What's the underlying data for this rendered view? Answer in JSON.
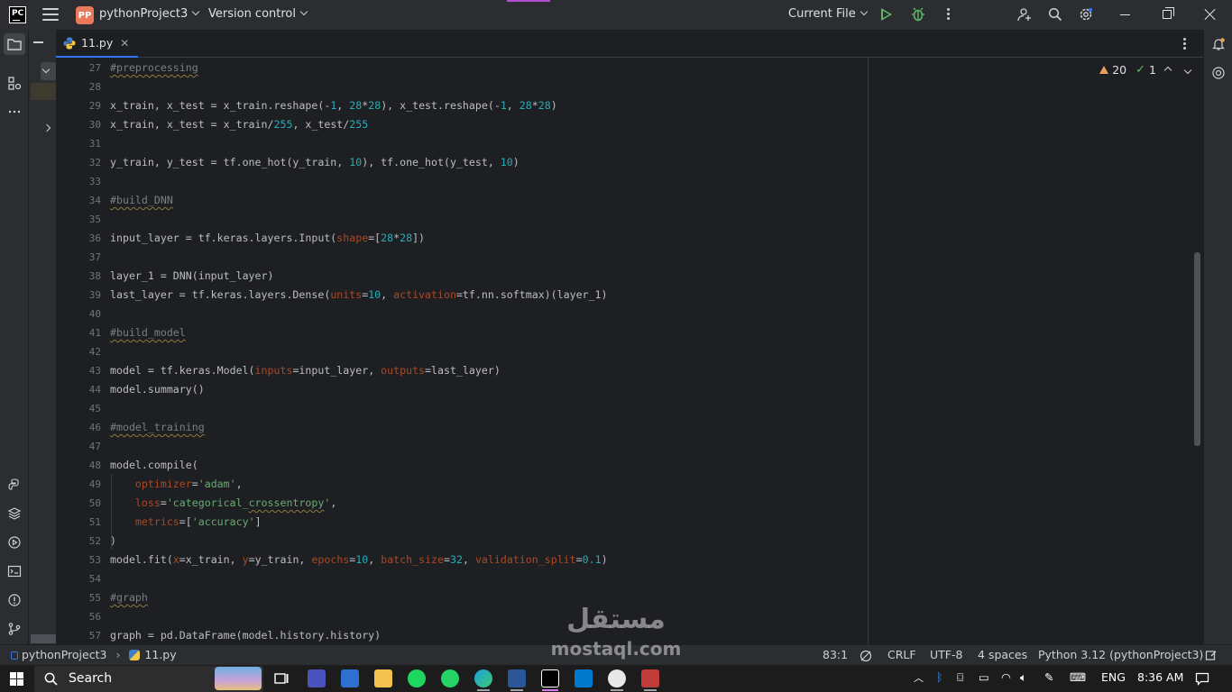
{
  "titlebar": {
    "project_badge": "PP",
    "project_name": "pythonProject3",
    "version_control": "Version control",
    "run_config": "Current File"
  },
  "tabs": [
    {
      "label": "11.py",
      "close": "✕"
    }
  ],
  "inspections": {
    "warnings": "20",
    "weak_warnings": "1"
  },
  "editor": {
    "lines": [
      {
        "no": "27",
        "html": "<span class=\"cm-w\">#preprocessing</span>"
      },
      {
        "no": "28",
        "html": ""
      },
      {
        "no": "29",
        "html": "x_train, x_test = x_train.reshape(-<span class=\"num\">1</span>, <span class=\"num\">28</span>*<span class=\"num\">28</span>), x_test.reshape(-<span class=\"num\">1</span>, <span class=\"num\">28</span>*<span class=\"num\">28</span>)"
      },
      {
        "no": "30",
        "html": "x_train, x_test = x_train/<span class=\"num\">255</span>, x_test/<span class=\"num\">255</span>"
      },
      {
        "no": "31",
        "html": ""
      },
      {
        "no": "32",
        "html": "y_train, y_test = tf.one_hot(y_train, <span class=\"num\">10</span>), tf.one_hot(y_test, <span class=\"num\">10</span>)"
      },
      {
        "no": "33",
        "html": ""
      },
      {
        "no": "34",
        "html": "<span class=\"cm-w\">#build_DNN</span>"
      },
      {
        "no": "35",
        "html": ""
      },
      {
        "no": "36",
        "html": "input_layer = tf.keras.layers.Input(<span class=\"kw\">shape</span>=[<span class=\"num\">28</span>*<span class=\"num\">28</span>])"
      },
      {
        "no": "37",
        "html": ""
      },
      {
        "no": "38",
        "html": "layer_1 = DNN(input_layer)"
      },
      {
        "no": "39",
        "html": "last_layer = tf.keras.layers.Dense(<span class=\"kw\">units</span>=<span class=\"num\">10</span>, <span class=\"kw\">activation</span>=tf.nn.softmax)(layer_1)"
      },
      {
        "no": "40",
        "html": ""
      },
      {
        "no": "41",
        "html": "<span class=\"cm-w\">#build_model</span>"
      },
      {
        "no": "42",
        "html": ""
      },
      {
        "no": "43",
        "html": "model = tf.keras.Model(<span class=\"kw\">inputs</span>=input_layer, <span class=\"kw\">outputs</span>=last_layer)"
      },
      {
        "no": "44",
        "html": "model.summary()"
      },
      {
        "no": "45",
        "html": ""
      },
      {
        "no": "46",
        "html": "<span class=\"cm-w\">#model_training</span>"
      },
      {
        "no": "47",
        "html": ""
      },
      {
        "no": "48",
        "html": "model.compile("
      },
      {
        "no": "49",
        "html": "    <span class=\"kw\">optimizer</span>=<span class=\"str\">'adam'</span>,"
      },
      {
        "no": "50",
        "html": "    <span class=\"kw\">loss</span>=<span class=\"str\">'categorical_<span class=\"cm-w\" style=\"color:#6aab73\">crossentropy</span>'</span>,"
      },
      {
        "no": "51",
        "html": "    <span class=\"kw\">metrics</span>=[<span class=\"str\">'accuracy'</span>]"
      },
      {
        "no": "52",
        "html": ")"
      },
      {
        "no": "53",
        "html": "model.fit(<span class=\"kw\">x</span>=x_train, <span class=\"kw\">y</span>=y_train, <span class=\"kw\">epochs</span>=<span class=\"num\">10</span>, <span class=\"kw\">batch_size</span>=<span class=\"num\">32</span>, <span class=\"kw\">validation_split</span>=<span class=\"num\">0.1</span>)"
      },
      {
        "no": "54",
        "html": ""
      },
      {
        "no": "55",
        "html": "<span class=\"cm-w\">#graph</span>"
      },
      {
        "no": "56",
        "html": ""
      },
      {
        "no": "57",
        "html": "graph = pd.DataFrame(model.history.history)"
      }
    ]
  },
  "statusbar": {
    "breadcrumb_project": "pythonProject3",
    "breadcrumb_file": "11.py",
    "cursor": "83:1",
    "line_sep": "CRLF",
    "encoding": "UTF-8",
    "indent": "4 spaces",
    "interpreter": "Python 3.12 (pythonProject3)"
  },
  "taskbar": {
    "search_label": "Search",
    "language": "ENG",
    "time": "8:36 AM"
  },
  "watermark": {
    "arabic": "مستقل",
    "latin": "mostaql.com"
  },
  "colors": {
    "accent": "#3574f0",
    "run": "#5fb865",
    "warning": "#e7a05a",
    "badge": "#e9795b"
  }
}
